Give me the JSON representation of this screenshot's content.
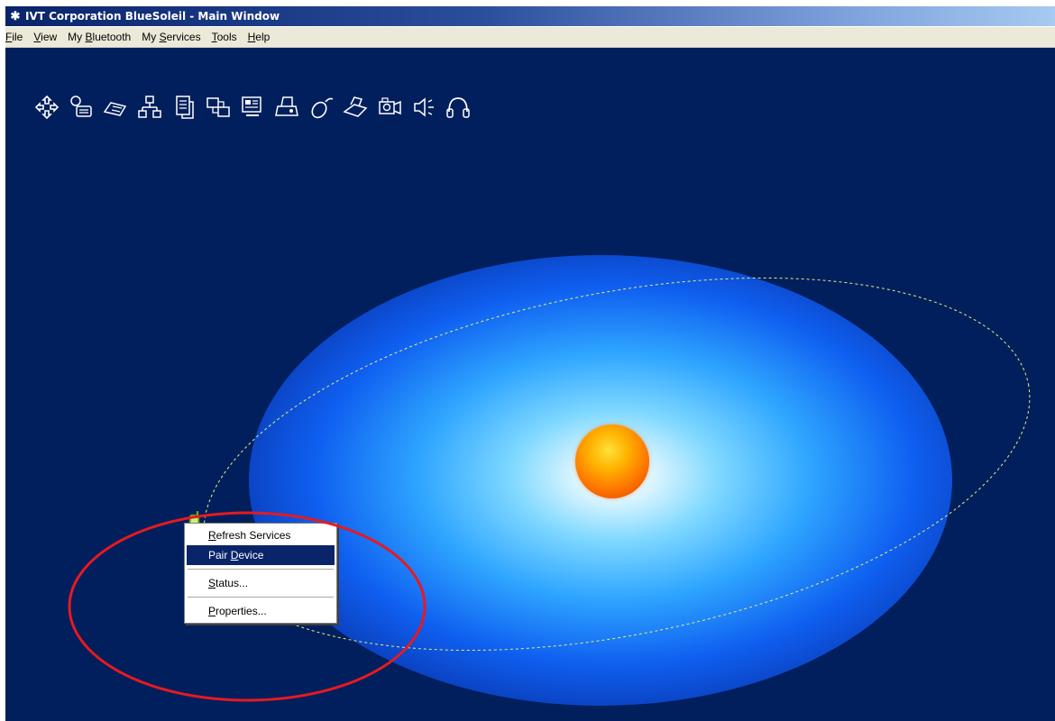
{
  "window": {
    "title": "IVT Corporation BlueSoleil - Main Window",
    "title_icon": "bluetooth-icon"
  },
  "menubar": {
    "items": [
      {
        "id": "file",
        "pre": "",
        "ul": "F",
        "post": "ile"
      },
      {
        "id": "view",
        "pre": "",
        "ul": "V",
        "post": "iew"
      },
      {
        "id": "my-bluetooth",
        "pre": "My ",
        "ul": "B",
        "post": "luetooth"
      },
      {
        "id": "my-services",
        "pre": "My ",
        "ul": "S",
        "post": "ervices"
      },
      {
        "id": "tools",
        "pre": "",
        "ul": "T",
        "post": "ools"
      },
      {
        "id": "help",
        "pre": "",
        "ul": "H",
        "post": "elp"
      }
    ]
  },
  "service_toolbar": {
    "icons": [
      "network-access-icon",
      "dialup-networking-icon",
      "serial-port-icon",
      "lan-access-icon",
      "file-transfer-icon",
      "sync-icon",
      "object-push-icon",
      "printer-icon",
      "mouse-hid-icon",
      "fax-icon",
      "camera-imaging-icon",
      "audio-gateway-icon",
      "headset-icon"
    ]
  },
  "context_menu": {
    "items": [
      {
        "pre": "",
        "ul": "R",
        "post": "efresh Services",
        "selected": false
      },
      {
        "pre": "Pair ",
        "ul": "D",
        "post": "evice",
        "selected": true
      },
      {
        "separator": true
      },
      {
        "pre": "",
        "ul": "S",
        "post": "tatus...",
        "selected": false
      },
      {
        "separator": true
      },
      {
        "pre": "",
        "ul": "P",
        "post": "roperties...",
        "selected": false
      }
    ]
  },
  "colors": {
    "canvas_background": "#001f5c",
    "highlight_ring": "#e8191f",
    "menu_selection": "#0a246a",
    "orbit_line": "#e6f07a"
  }
}
